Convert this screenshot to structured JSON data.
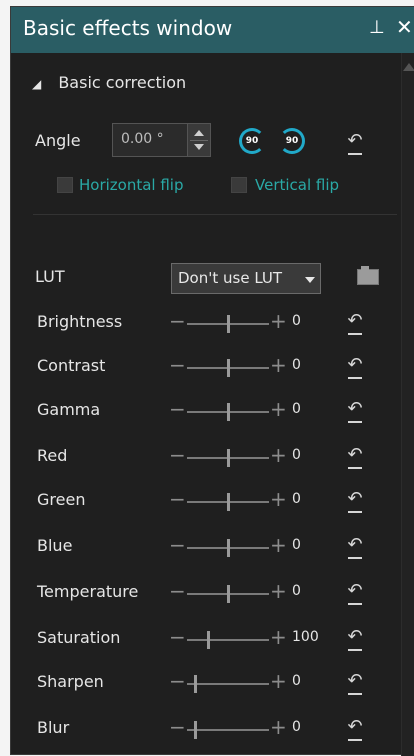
{
  "window": {
    "title": "Basic effects window",
    "pin_icon": "pin-icon",
    "close_icon": "close-icon"
  },
  "section": {
    "label": "Basic correction"
  },
  "angle": {
    "label": "Angle",
    "value": "0.00 °",
    "rotate_left": "90",
    "rotate_right": "90"
  },
  "flips": {
    "horizontal": "Horizontal flip",
    "vertical": "Vertical flip"
  },
  "lut": {
    "label": "LUT",
    "value": "Don't use LUT"
  },
  "adjustments": [
    {
      "name": "Brightness",
      "value": "0",
      "level": 0.5
    },
    {
      "name": "Contrast",
      "value": "0",
      "level": 0.5
    },
    {
      "name": "Gamma",
      "value": "0",
      "level": 0.5
    },
    {
      "name": "Red",
      "value": "0",
      "level": 0.5
    },
    {
      "name": "Green",
      "value": "0",
      "level": 0.5
    },
    {
      "name": "Blue",
      "value": "0",
      "level": 0.5
    },
    {
      "name": "Temperature",
      "value": "0",
      "level": 0.5
    },
    {
      "name": "Saturation",
      "value": "100",
      "level": 0.25
    },
    {
      "name": "Sharpen",
      "value": "0",
      "level": 0.1
    },
    {
      "name": "Blur",
      "value": "0",
      "level": 0.1
    }
  ],
  "colors": {
    "titlebar": "#2a5d64",
    "accent": "#21a9c9",
    "flip_label": "#2aa9a6"
  }
}
